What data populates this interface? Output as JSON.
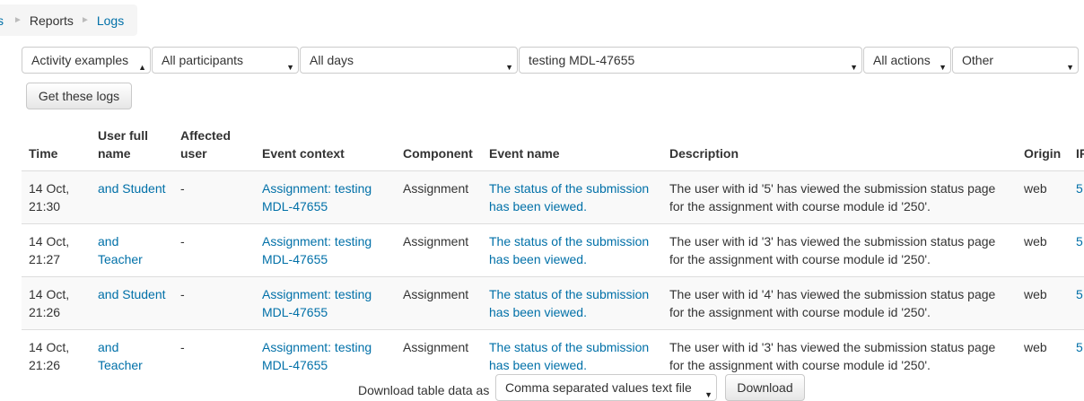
{
  "breadcrumb": {
    "cut_item": "s",
    "items": [
      "Reports",
      "Logs"
    ]
  },
  "filters": {
    "course": "Activity examples",
    "participants": "All participants",
    "days": "All days",
    "activity": "testing MDL-47655",
    "actions": "All actions",
    "origin": "Other",
    "submit_label": "Get these logs"
  },
  "table": {
    "headers": [
      "Time",
      "User full name",
      "Affected user",
      "Event context",
      "Component",
      "Event name",
      "Description",
      "Origin",
      "IP address"
    ],
    "rows": [
      {
        "time": "14 Oct, 21:30",
        "user": "and Student",
        "affected": "-",
        "context": "Assignment: testing MDL-47655",
        "component": "Assignment",
        "event": "The status of the submission has been viewed.",
        "description": "The user with id '5' has viewed the submission status page for the assignment with course module id '250'.",
        "origin": "web",
        "ip": "5"
      },
      {
        "time": "14 Oct, 21:27",
        "user": "and Teacher",
        "affected": "-",
        "context": "Assignment: testing MDL-47655",
        "component": "Assignment",
        "event": "The status of the submission has been viewed.",
        "description": "The user with id '3' has viewed the submission status page for the assignment with course module id '250'.",
        "origin": "web",
        "ip": "5"
      },
      {
        "time": "14 Oct, 21:26",
        "user": "and Student",
        "affected": "-",
        "context": "Assignment: testing MDL-47655",
        "component": "Assignment",
        "event": "The status of the submission has been viewed.",
        "description": "The user with id '4' has viewed the submission status page for the assignment with course module id '250'.",
        "origin": "web",
        "ip": "5"
      },
      {
        "time": "14 Oct, 21:26",
        "user": "and Teacher",
        "affected": "-",
        "context": "Assignment: testing MDL-47655",
        "component": "Assignment",
        "event": "The status of the submission has been viewed.",
        "description": "The user with id '3' has viewed the submission status page for the assignment with course module id '250'.",
        "origin": "web",
        "ip": "5"
      }
    ]
  },
  "download": {
    "label": "Download table data as",
    "format": "Comma separated values text file",
    "button": "Download"
  },
  "colors": {
    "link": "#0070a8",
    "row_stripe": "#f9f9f9",
    "breadcrumb_bg": "#f5f5f5"
  }
}
